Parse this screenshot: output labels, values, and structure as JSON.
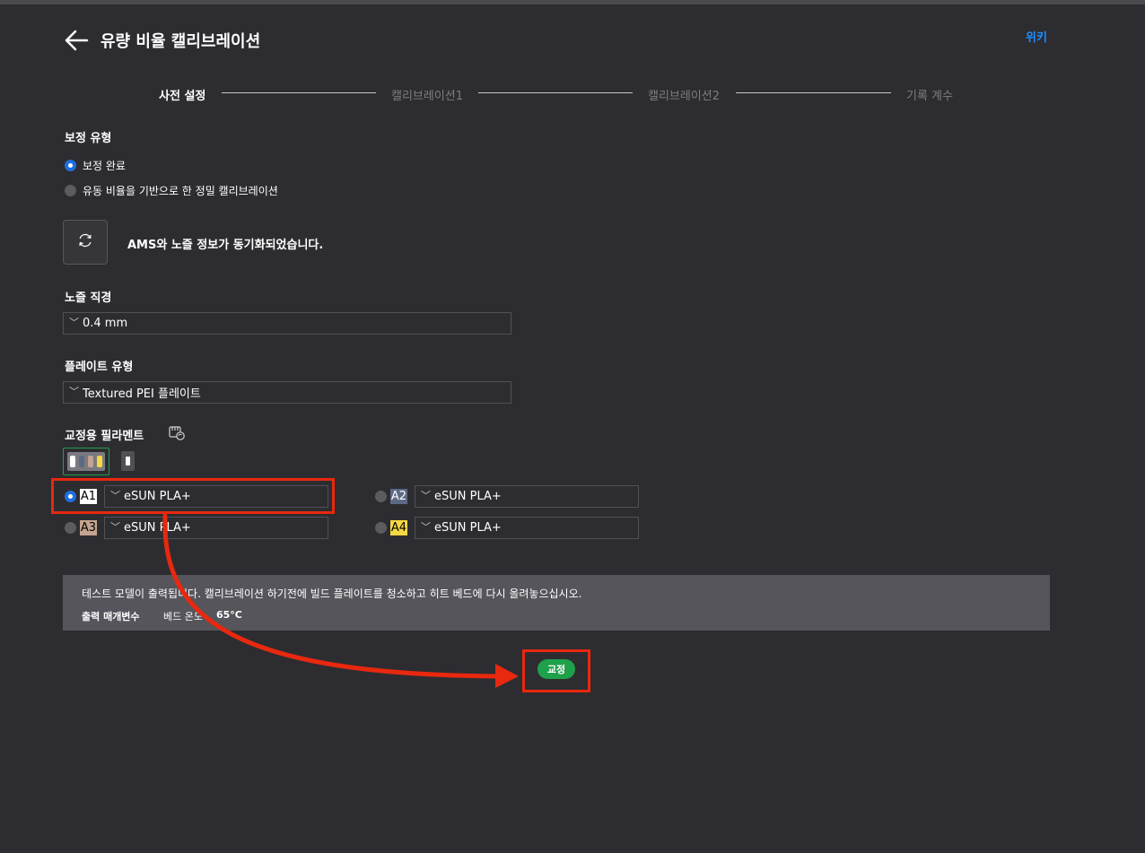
{
  "header": {
    "title": "유량 비율 캘리브레이션",
    "wiki_link": "위키"
  },
  "steps": [
    "사전 설정",
    "캘리브레이션1",
    "캘리브레이션2",
    "기록 계수"
  ],
  "calibration_type": {
    "label": "보정 유형",
    "options": [
      "보정 완료",
      "유동 비율을 기반으로 한 정밀 캘리브레이션"
    ],
    "selected_index": 0
  },
  "sync": {
    "message": "AMS와 노즐 정보가 동기화되었습니다."
  },
  "nozzle": {
    "label": "노즐 직경",
    "value": "0.4 mm"
  },
  "plate": {
    "label": "플레이트 유형",
    "value": "Textured PEI 플레이트"
  },
  "filament": {
    "label": "교정용 필라멘트",
    "slots": [
      {
        "id": "A1",
        "value": "eSUN PLA+",
        "color": "#ffffff",
        "text_color": "#000000",
        "selected": true
      },
      {
        "id": "A2",
        "value": "eSUN PLA+",
        "color": "#5d6a85",
        "text_color": "#ffffff",
        "selected": false
      },
      {
        "id": "A3",
        "value": "eSUN PLA+",
        "color": "#c4a390",
        "text_color": "#000000",
        "selected": false
      },
      {
        "id": "A4",
        "value": "eSUN PLA+",
        "color": "#f5d842",
        "text_color": "#000000",
        "selected": false
      }
    ]
  },
  "notice": {
    "message": "테스트 모델이 출력됩니다. 캘리브레이션 하기전에 빌드 플레이트를 청소하고 히트 베드에 다시 올려놓으십시오.",
    "params_label": "출력 매개변수",
    "bed_temp_label": "베드 온도",
    "bed_temp_value": "65°C"
  },
  "calibrate_button": "교정",
  "colors": {
    "accent_green": "#1fa04a",
    "accent_blue": "#1f6fe0",
    "highlight_red": "#e8280f",
    "link_blue": "#1f8cff"
  }
}
